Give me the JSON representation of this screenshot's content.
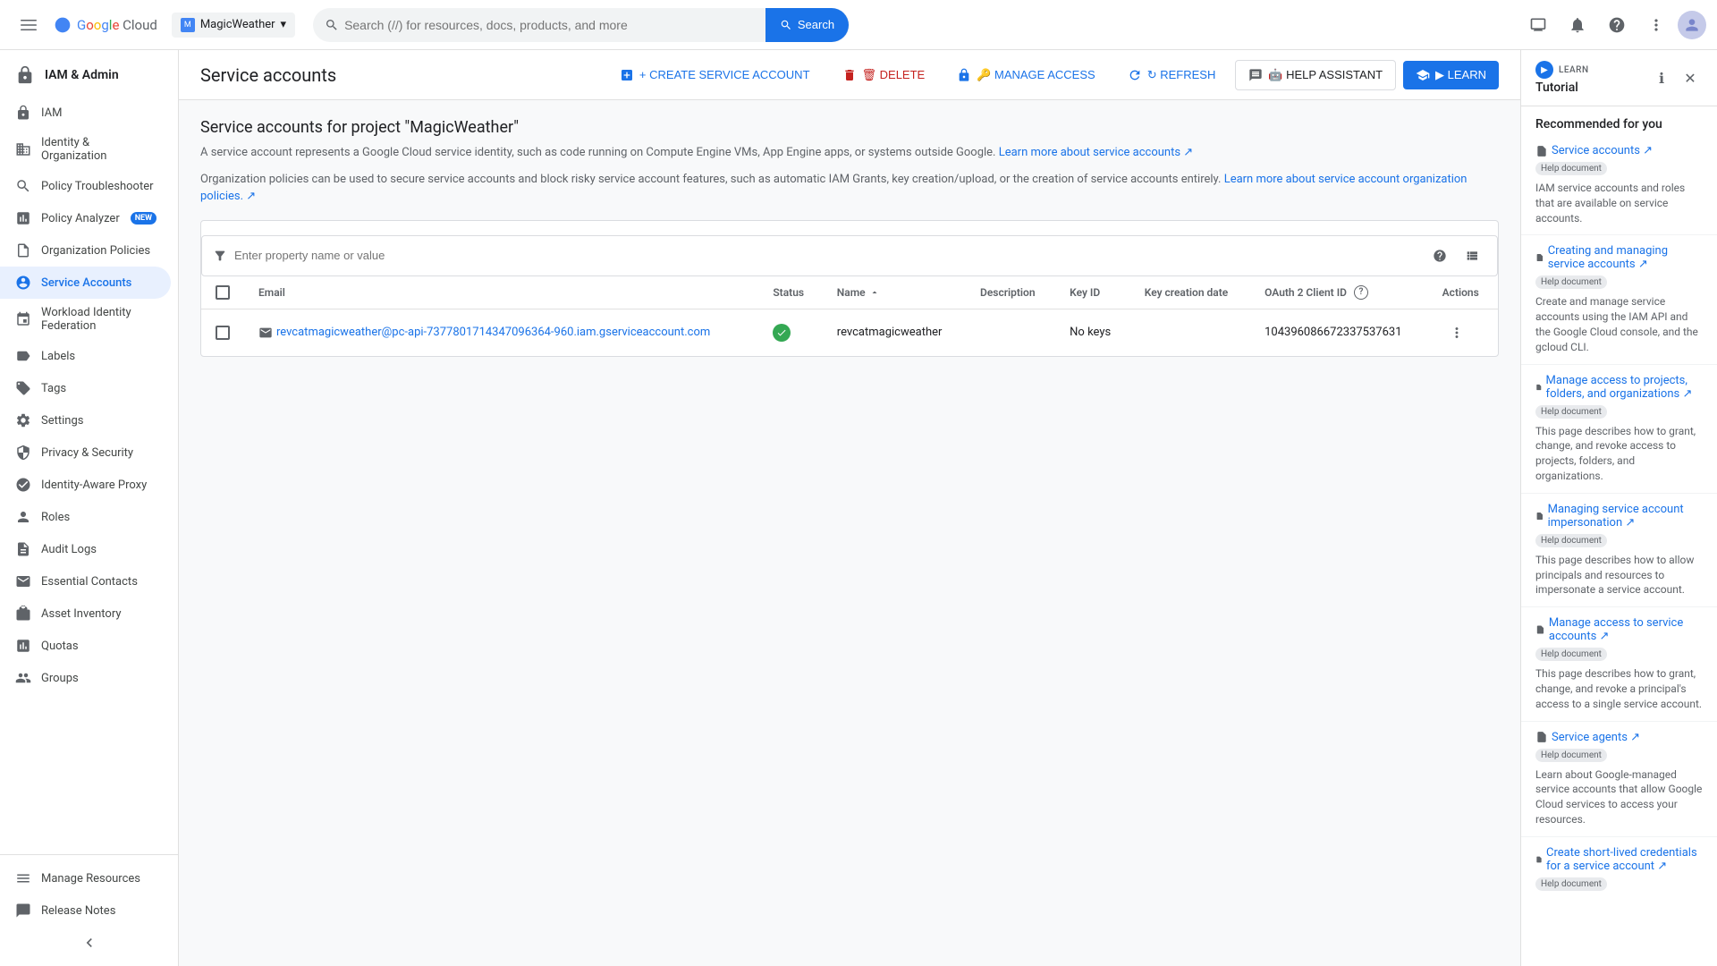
{
  "topbar": {
    "menu_icon": "☰",
    "logo": {
      "g": "G",
      "o1": "o",
      "o2": "o",
      "g2": "g",
      "l": "l",
      "e": "e",
      "cloud": " Cloud"
    },
    "project": {
      "name": "MagicWeather",
      "dropdown_icon": "▾"
    },
    "search": {
      "placeholder": "Search (//) for resources, docs, products, and more",
      "button_label": "Search"
    },
    "icons": {
      "monitor": "⬜",
      "bell": "🔔",
      "help": "?",
      "more": "⋮"
    }
  },
  "sidebar": {
    "header": {
      "title": "IAM & Admin"
    },
    "items": [
      {
        "id": "iam",
        "label": "IAM",
        "icon": "🔑"
      },
      {
        "id": "identity-org",
        "label": "Identity & Organization",
        "icon": "🏢"
      },
      {
        "id": "policy-troubleshooter",
        "label": "Policy Troubleshooter",
        "icon": "🔍"
      },
      {
        "id": "policy-analyzer",
        "label": "Policy Analyzer",
        "icon": "📊",
        "badge": "NEW"
      },
      {
        "id": "org-policies",
        "label": "Organization Policies",
        "icon": "📋"
      },
      {
        "id": "service-accounts",
        "label": "Service Accounts",
        "icon": "⚙",
        "active": true
      },
      {
        "id": "workload-identity",
        "label": "Workload Identity Federation",
        "icon": "🔗"
      },
      {
        "id": "labels",
        "label": "Labels",
        "icon": "🏷"
      },
      {
        "id": "tags",
        "label": "Tags",
        "icon": "🏷"
      },
      {
        "id": "settings",
        "label": "Settings",
        "icon": "⚙"
      },
      {
        "id": "privacy-security",
        "label": "Privacy & Security",
        "icon": "🔒"
      },
      {
        "id": "identity-aware-proxy",
        "label": "Identity-Aware Proxy",
        "icon": "🛡"
      },
      {
        "id": "roles",
        "label": "Roles",
        "icon": "👤"
      },
      {
        "id": "audit-logs",
        "label": "Audit Logs",
        "icon": "📄"
      },
      {
        "id": "essential-contacts",
        "label": "Essential Contacts",
        "icon": "📧"
      },
      {
        "id": "asset-inventory",
        "label": "Asset Inventory",
        "icon": "📦"
      },
      {
        "id": "quotas",
        "label": "Quotas",
        "icon": "📈"
      },
      {
        "id": "groups",
        "label": "Groups",
        "icon": "👥"
      }
    ],
    "bottom_items": [
      {
        "id": "manage-resources",
        "label": "Manage Resources",
        "icon": "🗂"
      },
      {
        "id": "release-notes",
        "label": "Release Notes",
        "icon": "📝"
      }
    ],
    "collapse_icon": "«"
  },
  "page": {
    "title": "Service accounts",
    "actions": {
      "create": "+ CREATE SERVICE ACCOUNT",
      "delete": "🗑 DELETE",
      "manage_access": "🔑 MANAGE ACCESS",
      "refresh": "↻ REFRESH",
      "help_assistant": "🤖 HELP ASSISTANT",
      "learn": "▶ LEARN"
    },
    "content": {
      "section_title": "Service accounts for project \"MagicWeather\"",
      "desc1": "A service account represents a Google Cloud service identity, such as code running on Compute Engine VMs, App Engine apps, or systems outside Google.",
      "desc1_link": "Learn more about service accounts ↗",
      "desc2": "Organization policies can be used to secure service accounts and block risky service account features, such as automatic IAM Grants, key creation/upload, or the creation of service accounts entirely.",
      "desc2_link": "Learn more about service account organization policies. ↗"
    },
    "filter": {
      "placeholder": "Enter property name or value"
    },
    "table": {
      "columns": [
        "Email",
        "Status",
        "Name",
        "Description",
        "Key ID",
        "Key creation date",
        "OAuth 2 Client ID",
        "Actions"
      ],
      "rows": [
        {
          "email": "revcatmagicweather@pc-api-7377801714347096364-960.iam.gserviceaccount.com",
          "status": "active",
          "name": "revcatmagicweather",
          "description": "",
          "key_id": "No keys",
          "key_creation_date": "",
          "oauth2_client_id": "104396086672337537631",
          "actions": "⋮"
        }
      ]
    }
  },
  "right_panel": {
    "learn_label": "LEARN",
    "tutorial_label": "Tutorial",
    "section_title": "Recommended for you",
    "header_icons": {
      "info": "ℹ",
      "close": "✕"
    },
    "items": [
      {
        "id": "service-accounts-doc",
        "title": "Service accounts ↗",
        "badge": "Help document",
        "desc": "IAM service accounts and roles that are available on service accounts."
      },
      {
        "id": "creating-managing-doc",
        "title": "Creating and managing service accounts ↗",
        "badge": "Help document",
        "desc": "Create and manage service accounts using the IAM API and the Google Cloud console, and the gcloud CLI."
      },
      {
        "id": "manage-access-doc",
        "title": "Manage access to projects, folders, and organizations ↗",
        "badge": "Help document",
        "desc": "This page describes how to grant, change, and revoke access to projects, folders, and organizations."
      },
      {
        "id": "impersonation-doc",
        "title": "Managing service account impersonation ↗",
        "badge": "Help document",
        "desc": "This page describes how to allow principals and resources to impersonate a service account."
      },
      {
        "id": "manage-access-sa-doc",
        "title": "Manage access to service accounts ↗",
        "badge": "Help document",
        "desc": "This page describes how to grant, change, and revoke a principal's access to a single service account."
      },
      {
        "id": "service-agents-doc",
        "title": "Service agents ↗",
        "badge": "Help document",
        "desc": "Learn about Google-managed service accounts that allow Google Cloud services to access your resources."
      },
      {
        "id": "short-lived-doc",
        "title": "Create short-lived credentials for a service account ↗",
        "badge": "Help document",
        "desc": ""
      }
    ]
  }
}
